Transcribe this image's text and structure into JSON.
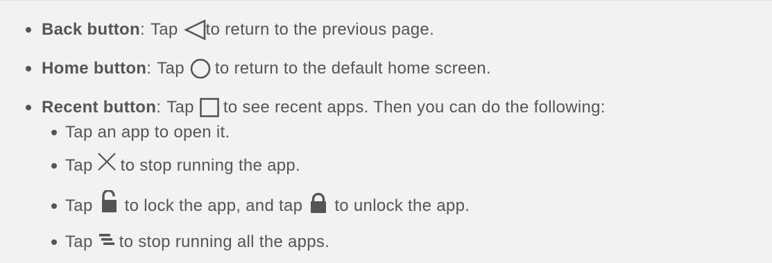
{
  "items": [
    {
      "label": "Back button",
      "colon": ":",
      "tap": "Tap",
      "icon": "back-triangle-icon",
      "text": "to return to the previous page."
    },
    {
      "label": "Home button",
      "colon": ":",
      "tap": "Tap",
      "icon": "home-circle-icon",
      "text": "to return to the default home screen."
    },
    {
      "label": "Recent button",
      "colon": ":",
      "tap": "Tap",
      "icon": "recent-square-icon",
      "text": "to see recent apps. Then you can do the following:"
    }
  ],
  "subitems": [
    {
      "text": "Tap an app to open it."
    },
    {
      "tap": "Tap",
      "icon": "close-x-icon",
      "text": "to stop running the app."
    },
    {
      "tap": "Tap",
      "icon": "unlocked-padlock-icon",
      "text_a": "to lock the app, and tap",
      "icon_b": "locked-padlock-icon",
      "text_b": "to unlock the app."
    },
    {
      "tap": "Tap",
      "icon": "clear-all-icon",
      "text": "to stop running all the apps."
    }
  ],
  "colors": {
    "text": "#555555",
    "background": "#f2f2f2"
  }
}
